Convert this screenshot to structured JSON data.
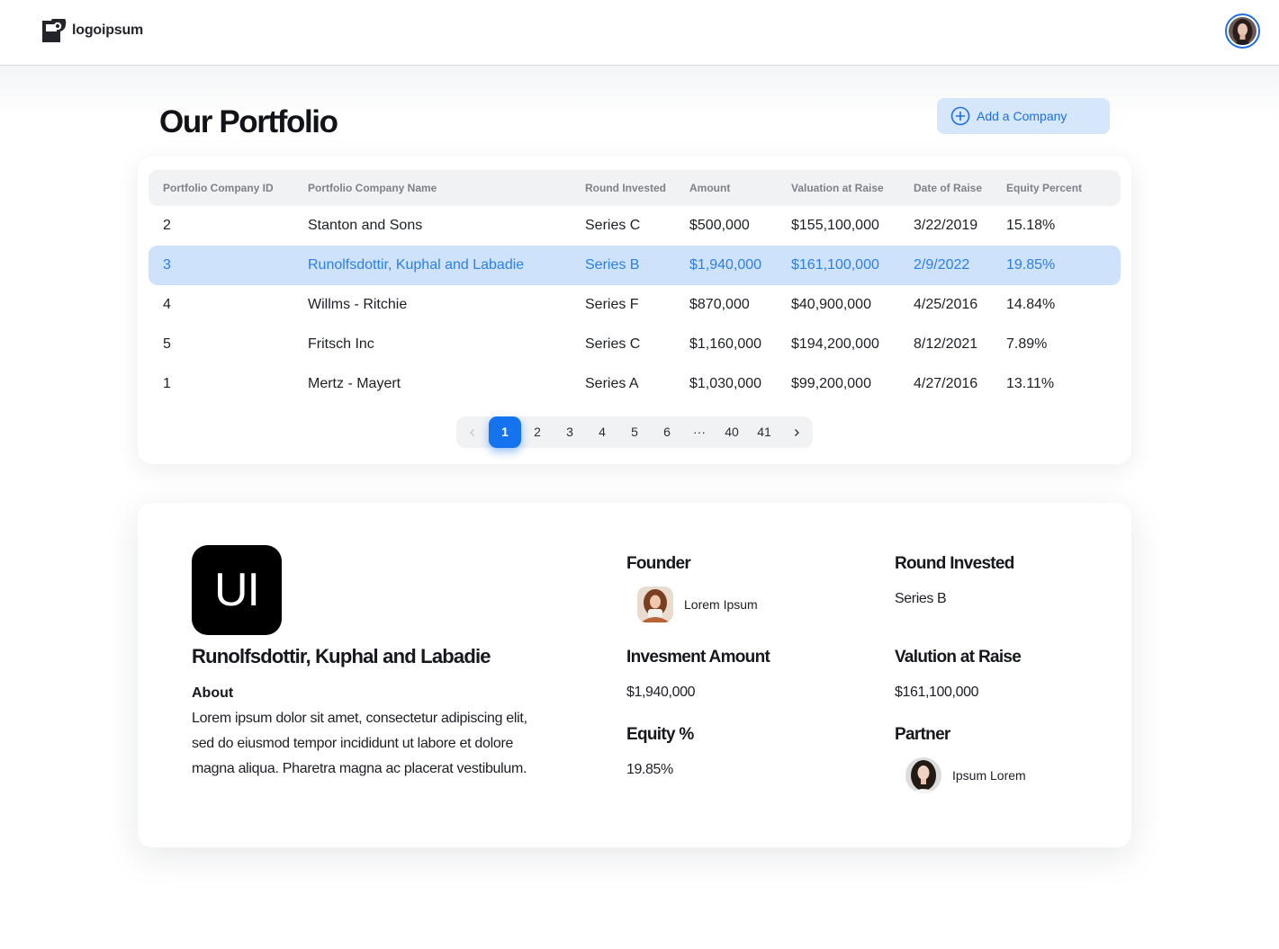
{
  "header": {
    "logo_text": "logoipsum",
    "avatar_icon": "user-avatar"
  },
  "page": {
    "title": "Our Portfolio",
    "add_button_label": "Add a Company",
    "add_button_icon": "plus-circle-icon",
    "accent_color": "#1573f0"
  },
  "table": {
    "columns": [
      "Portfolio Company ID",
      "Portfolio Company Name",
      "Round Invested",
      "Amount",
      "Valuation at Raise",
      "Date of Raise",
      "Equity Percent"
    ],
    "rows": [
      {
        "id": "2",
        "name": "Stanton and Sons",
        "round": "Series C",
        "amount": "$500,000",
        "valuation": "$155,100,000",
        "date": "3/22/2019",
        "equity": "15.18%"
      },
      {
        "id": "3",
        "name": "Runolfsdottir, Kuphal and Labadie",
        "round": "Series B",
        "amount": "$1,940,000",
        "valuation": "$161,100,000",
        "date": "2/9/2022",
        "equity": "19.85%"
      },
      {
        "id": "4",
        "name": "Willms - Ritchie",
        "round": "Series F",
        "amount": "$870,000",
        "valuation": "$40,900,000",
        "date": "4/25/2016",
        "equity": "14.84%"
      },
      {
        "id": "5",
        "name": "Fritsch Inc",
        "round": "Series C",
        "amount": "$1,160,000",
        "valuation": "$194,200,000",
        "date": "8/12/2021",
        "equity": "7.89%"
      },
      {
        "id": "1",
        "name": "Mertz - Mayert",
        "round": "Series A",
        "amount": "$1,030,000",
        "valuation": "$99,200,000",
        "date": "4/27/2016",
        "equity": "13.11%"
      }
    ],
    "selected_row_id": "3"
  },
  "pagination": {
    "prev_icon": "chevron-left-icon",
    "next_icon": "chevron-right-icon",
    "pages": [
      "1",
      "2",
      "3",
      "4",
      "5",
      "6",
      "···",
      "40",
      "41"
    ],
    "current": "1"
  },
  "detail": {
    "logo_text": "UI",
    "company_name": "Runolfsdottir, Kuphal and Labadie",
    "about_label": "About",
    "about_text": "Lorem ipsum dolor sit amet, consectetur adipiscing elit, sed do eiusmod tempor incididunt ut labore et dolore magna aliqua. Pharetra magna ac placerat vestibulum.",
    "founder_label": "Founder",
    "founder_name": "Lorem Ipsum",
    "round_label": "Round Invested",
    "round_value": "Series B",
    "investment_label": "Invesment Amount",
    "investment_value": "$1,940,000",
    "valuation_label": "Valution at Raise",
    "valuation_value": "$161,100,000",
    "equity_label": "Equity %",
    "equity_value": "19.85%",
    "partner_label": "Partner",
    "partner_name": "Ipsum Lorem"
  }
}
